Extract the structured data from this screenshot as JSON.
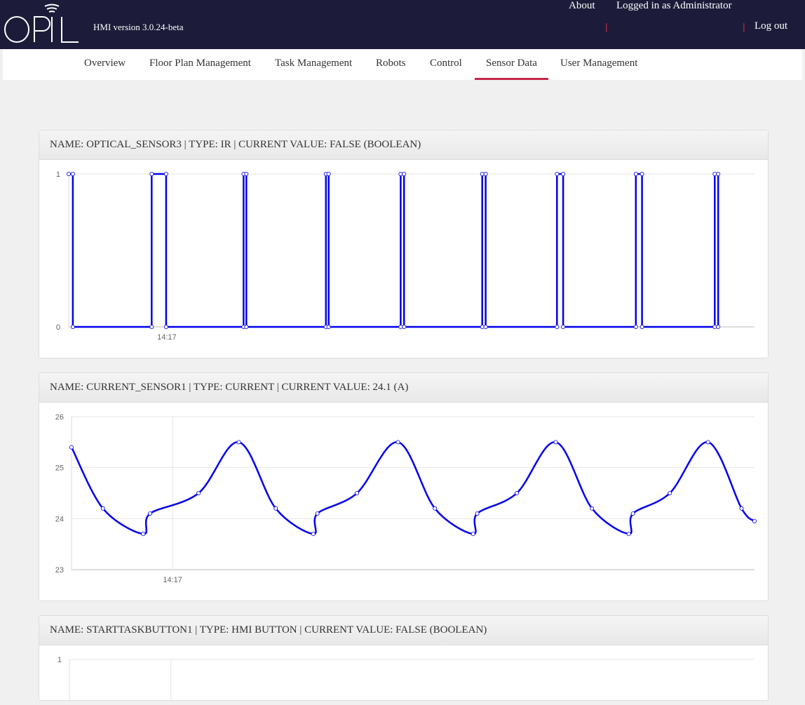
{
  "header": {
    "logo_text": "OPIL",
    "version": "HMI version 3.0.24-beta",
    "links": [
      "About",
      "Logged in as Administrator",
      "Log out"
    ],
    "separator": "|"
  },
  "nav": {
    "items": [
      "Overview",
      "Floor Plan Management",
      "Task Management",
      "Robots",
      "Control",
      "Sensor Data",
      "User Management"
    ],
    "active": "Sensor Data"
  },
  "colors": {
    "header_bg": "#1c1c3a",
    "accent": "#c8284a",
    "series": "#0000ee"
  },
  "panels": [
    {
      "title": "NAME: OPTICAL_SENSOR3 | TYPE: IR | CURRENT VALUE: FALSE (BOOLEAN)"
    },
    {
      "title": "NAME: CURRENT_SENSOR1 | TYPE: CURRENT | CURRENT VALUE: 24.1 (A)"
    },
    {
      "title": "NAME: STARTTASKBUTTON1 | TYPE: HMI BUTTON | CURRENT VALUE: FALSE (BOOLEAN)"
    }
  ],
  "chart_data": [
    {
      "type": "line",
      "step": true,
      "x_tick_labels": [
        "14:17"
      ],
      "y_ticks": [
        0,
        1
      ],
      "ylim": [
        0,
        1
      ],
      "xlim": [
        0,
        100
      ],
      "x_tick_positions": [
        14.3
      ],
      "grid": true,
      "points": [
        [
          0,
          1
        ],
        [
          0.6,
          1
        ],
        [
          0.6,
          0
        ],
        [
          12.1,
          0
        ],
        [
          12.1,
          1
        ],
        [
          14.2,
          1
        ],
        [
          14.2,
          0
        ],
        [
          25.5,
          0
        ],
        [
          25.5,
          1
        ],
        [
          25.9,
          1
        ],
        [
          25.9,
          0
        ],
        [
          37.5,
          0
        ],
        [
          37.5,
          1
        ],
        [
          37.9,
          1
        ],
        [
          37.9,
          0
        ],
        [
          48.4,
          0
        ],
        [
          48.4,
          1
        ],
        [
          48.9,
          1
        ],
        [
          48.9,
          0
        ],
        [
          60.3,
          0
        ],
        [
          60.3,
          1
        ],
        [
          60.8,
          1
        ],
        [
          60.8,
          0
        ],
        [
          71.2,
          0
        ],
        [
          71.2,
          1
        ],
        [
          72.1,
          1
        ],
        [
          72.1,
          0
        ],
        [
          82.7,
          0
        ],
        [
          82.7,
          1
        ],
        [
          83.6,
          1
        ],
        [
          83.6,
          0
        ],
        [
          94.2,
          0
        ],
        [
          94.2,
          1
        ],
        [
          94.7,
          1
        ],
        [
          94.7,
          0
        ]
      ]
    },
    {
      "type": "line",
      "x_tick_labels": [
        "14:17"
      ],
      "y_ticks": [
        23,
        24,
        25,
        26
      ],
      "ylim": [
        23,
        26
      ],
      "xlim": [
        0,
        100
      ],
      "x_tick_positions": [
        14.8
      ],
      "grid": true,
      "points": [
        [
          0,
          25.4
        ],
        [
          4.6,
          24.2
        ],
        [
          10.5,
          23.7
        ],
        [
          11.5,
          24.1
        ],
        [
          18.6,
          24.5
        ],
        [
          24.5,
          25.5
        ],
        [
          29.9,
          24.2
        ],
        [
          35.4,
          23.7
        ],
        [
          36.0,
          24.1
        ],
        [
          41.8,
          24.5
        ],
        [
          47.8,
          25.5
        ],
        [
          53.2,
          24.2
        ],
        [
          58.8,
          23.7
        ],
        [
          59.4,
          24.1
        ],
        [
          65.2,
          24.5
        ],
        [
          70.9,
          25.5
        ],
        [
          76.2,
          24.2
        ],
        [
          81.6,
          23.7
        ],
        [
          82.2,
          24.1
        ],
        [
          87.6,
          24.5
        ],
        [
          93.2,
          25.5
        ],
        [
          98.1,
          24.2
        ],
        [
          100,
          23.95
        ]
      ]
    },
    {
      "type": "line",
      "x_tick_labels": [],
      "y_ticks": [
        1
      ],
      "ylim": [
        0,
        1
      ],
      "xlim": [
        0,
        100
      ],
      "x_tick_positions": [
        14.8
      ],
      "grid": true,
      "points": []
    }
  ]
}
